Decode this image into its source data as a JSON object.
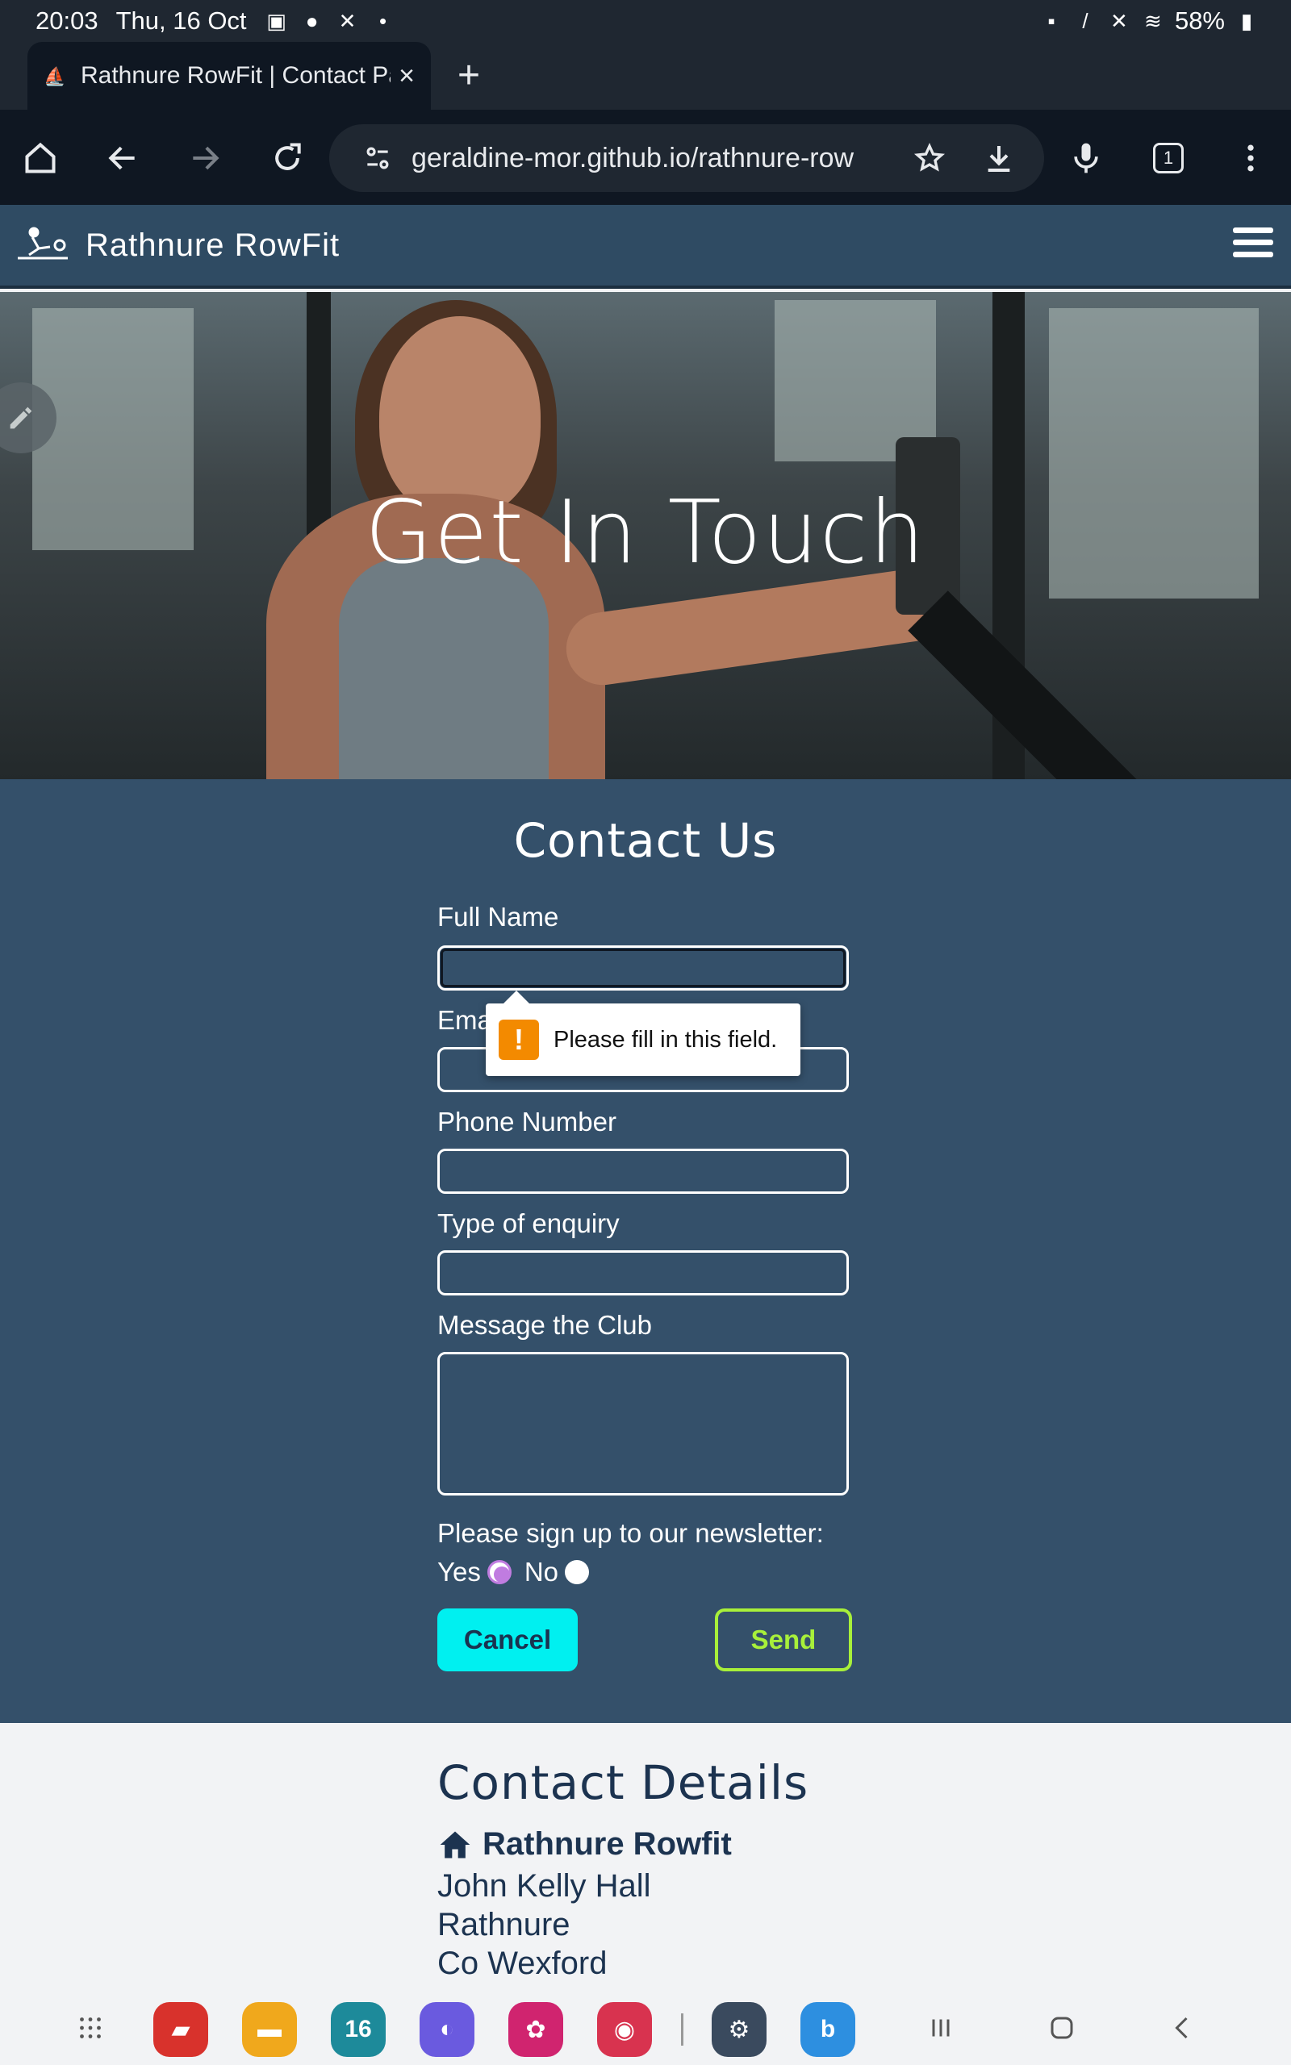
{
  "status_bar": {
    "time": "20:03",
    "date": "Thu, 16 Oct",
    "battery": "58%"
  },
  "browser": {
    "tab_title": "Rathnure RowFit | Contact Pa",
    "url": "geraldine-mor.github.io/rathnure-row",
    "tab_count": "1"
  },
  "site": {
    "brand": "Rathnure RowFit"
  },
  "hero": {
    "title": "Get In Touch"
  },
  "form": {
    "heading": "Contact Us",
    "full_name_label": "Full Name",
    "email_label": "Ema",
    "phone_label": "Phone Number",
    "enquiry_label": "Type of enquiry",
    "message_label": "Message the Club",
    "newsletter_label": "Please sign up to our newsletter:",
    "newsletter_yes": "Yes",
    "newsletter_no": "No",
    "newsletter_selected": "Yes",
    "cancel_label": "Cancel",
    "send_label": "Send",
    "validation_message": "Please fill in this field."
  },
  "details": {
    "heading": "Contact Details",
    "name": "Rathnure Rowfit",
    "address": [
      "John Kelly Hall",
      "Rathnure",
      "Co Wexford"
    ]
  },
  "dock": {
    "calendar_day": "16"
  },
  "colors": {
    "nav_bg": "#2f4b63",
    "section_bg": "#34506a",
    "cancel_bg": "#00f0f0",
    "send_border": "#a8f03a",
    "heading_dark": "#1c3350"
  }
}
